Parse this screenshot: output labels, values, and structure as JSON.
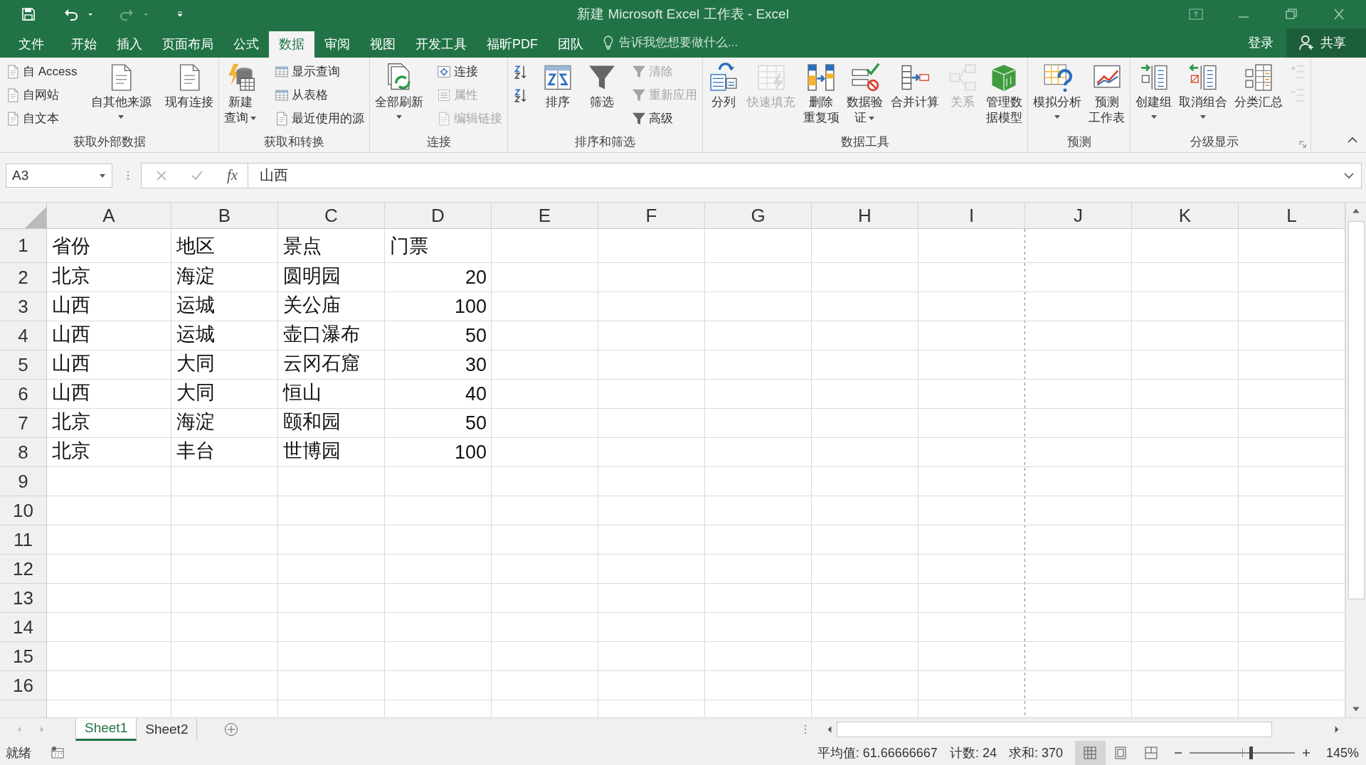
{
  "window": {
    "title": "新建 Microsoft Excel 工作表 - Excel"
  },
  "ribbon_tabs": [
    {
      "label": "文件",
      "selected": false
    },
    {
      "label": "开始",
      "selected": false
    },
    {
      "label": "插入",
      "selected": false
    },
    {
      "label": "页面布局",
      "selected": false
    },
    {
      "label": "公式",
      "selected": false
    },
    {
      "label": "数据",
      "selected": true
    },
    {
      "label": "审阅",
      "selected": false
    },
    {
      "label": "视图",
      "selected": false
    },
    {
      "label": "开发工具",
      "selected": false
    },
    {
      "label": "福昕PDF",
      "selected": false
    },
    {
      "label": "团队",
      "selected": false
    }
  ],
  "tell_me": {
    "placeholder": "告诉我您想要做什么..."
  },
  "account": {
    "sign_in": "登录",
    "share": "共享"
  },
  "ribbon": {
    "groups": [
      {
        "label": "获取外部数据",
        "items": [
          {
            "kind": "stack",
            "buttons": [
              {
                "label": "自 Access",
                "disabled": false
              },
              {
                "label": "自网站",
                "disabled": false
              },
              {
                "label": "自文本",
                "disabled": false
              }
            ]
          },
          {
            "kind": "large",
            "lines": [
              "自其他来源"
            ],
            "dropdown": true,
            "disabled": false
          },
          {
            "kind": "large",
            "lines": [
              "现有连接"
            ],
            "dropdown": false,
            "disabled": false
          }
        ]
      },
      {
        "label": "获取和转换",
        "items": [
          {
            "kind": "large",
            "lines": [
              "新建",
              "查询"
            ],
            "dropdown": true,
            "disabled": false
          },
          {
            "kind": "stack",
            "buttons": [
              {
                "label": "显示查询",
                "disabled": false
              },
              {
                "label": "从表格",
                "disabled": false
              },
              {
                "label": "最近使用的源",
                "disabled": false
              }
            ]
          }
        ]
      },
      {
        "label": "连接",
        "items": [
          {
            "kind": "large",
            "lines": [
              "全部刷新"
            ],
            "dropdown": true,
            "disabled": false
          },
          {
            "kind": "stack",
            "buttons": [
              {
                "label": "连接",
                "disabled": false
              },
              {
                "label": "属性",
                "disabled": true
              },
              {
                "label": "编辑链接",
                "disabled": true
              }
            ]
          }
        ]
      },
      {
        "label": "排序和筛选",
        "items": [
          {
            "kind": "stack",
            "buttons": [
              {
                "disabled": false
              },
              {
                "disabled": false
              }
            ]
          },
          {
            "kind": "large",
            "lines": [
              "排序"
            ],
            "dropdown": false,
            "disabled": false
          },
          {
            "kind": "large",
            "lines": [
              "筛选"
            ],
            "dropdown": false,
            "disabled": false
          },
          {
            "kind": "stack",
            "buttons": [
              {
                "label": "清除",
                "disabled": true
              },
              {
                "label": "重新应用",
                "disabled": true
              },
              {
                "label": "高级",
                "disabled": false
              }
            ]
          }
        ]
      },
      {
        "label": "数据工具",
        "items": [
          {
            "kind": "large",
            "lines": [
              "分列"
            ],
            "dropdown": false,
            "disabled": false
          },
          {
            "kind": "large",
            "lines": [
              "快速填充"
            ],
            "dropdown": false,
            "disabled": true
          },
          {
            "kind": "large",
            "lines": [
              "删除",
              "重复项"
            ],
            "dropdown": false,
            "disabled": false
          },
          {
            "kind": "large",
            "lines": [
              "数据验",
              "证"
            ],
            "dropdown": true,
            "disabled": false
          },
          {
            "kind": "large",
            "lines": [
              "合并计算"
            ],
            "dropdown": false,
            "disabled": false
          },
          {
            "kind": "large",
            "lines": [
              "关系"
            ],
            "dropdown": false,
            "disabled": true
          },
          {
            "kind": "large",
            "lines": [
              "管理数",
              "据模型"
            ],
            "dropdown": false,
            "disabled": false
          }
        ]
      },
      {
        "label": "预测",
        "items": [
          {
            "kind": "large",
            "lines": [
              "模拟分析"
            ],
            "dropdown": true,
            "disabled": false
          },
          {
            "kind": "large",
            "lines": [
              "预测",
              "工作表"
            ],
            "dropdown": false,
            "disabled": false
          }
        ]
      },
      {
        "label": "分级显示",
        "items": [
          {
            "kind": "large",
            "lines": [
              "创建组"
            ],
            "dropdown": true,
            "disabled": false
          },
          {
            "kind": "large",
            "lines": [
              "取消组合"
            ],
            "dropdown": true,
            "disabled": false
          },
          {
            "kind": "large",
            "lines": [
              "分类汇总"
            ],
            "dropdown": false,
            "disabled": false
          },
          {
            "kind": "stack",
            "buttons": [
              {
                "disabled": true
              },
              {
                "disabled": true
              }
            ]
          }
        ]
      }
    ]
  },
  "name_box": {
    "value": "A3"
  },
  "formula_bar": {
    "function_label": "fx",
    "value": "山西"
  },
  "sheet": {
    "columns": [
      "A",
      "B",
      "C",
      "D",
      "E",
      "F",
      "G",
      "H",
      "I",
      "J",
      "K",
      "L"
    ],
    "rows": [
      {
        "header": "1",
        "cells": [
          {
            "text": "省份",
            "kind": "text"
          },
          {
            "text": "地区",
            "kind": "text"
          },
          {
            "text": "景点",
            "kind": "text"
          },
          {
            "text": "门票",
            "kind": "text"
          }
        ]
      },
      {
        "header": "2",
        "cells": [
          {
            "text": "北京",
            "kind": "text"
          },
          {
            "text": "海淀",
            "kind": "text"
          },
          {
            "text": "圆明园",
            "kind": "text"
          },
          {
            "text": "20",
            "kind": "number"
          }
        ]
      },
      {
        "header": "3",
        "cells": [
          {
            "text": "山西",
            "kind": "text"
          },
          {
            "text": "运城",
            "kind": "text"
          },
          {
            "text": "关公庙",
            "kind": "text"
          },
          {
            "text": "100",
            "kind": "number"
          }
        ]
      },
      {
        "header": "4",
        "cells": [
          {
            "text": "山西",
            "kind": "text"
          },
          {
            "text": "运城",
            "kind": "text"
          },
          {
            "text": "壶口瀑布",
            "kind": "text"
          },
          {
            "text": "50",
            "kind": "number"
          }
        ]
      },
      {
        "header": "5",
        "cells": [
          {
            "text": "山西",
            "kind": "text"
          },
          {
            "text": "大同",
            "kind": "text"
          },
          {
            "text": "云冈石窟",
            "kind": "text"
          },
          {
            "text": "30",
            "kind": "number"
          }
        ]
      },
      {
        "header": "6",
        "cells": [
          {
            "text": "山西",
            "kind": "text"
          },
          {
            "text": "大同",
            "kind": "text"
          },
          {
            "text": "恒山",
            "kind": "text"
          },
          {
            "text": "40",
            "kind": "number"
          }
        ]
      },
      {
        "header": "7",
        "cells": [
          {
            "text": "北京",
            "kind": "text"
          },
          {
            "text": "海淀",
            "kind": "text"
          },
          {
            "text": "颐和园",
            "kind": "text"
          },
          {
            "text": "50",
            "kind": "number"
          }
        ]
      },
      {
        "header": "8",
        "cells": [
          {
            "text": "北京",
            "kind": "text"
          },
          {
            "text": "丰台",
            "kind": "text"
          },
          {
            "text": "世博园",
            "kind": "text"
          },
          {
            "text": "100",
            "kind": "number"
          }
        ]
      },
      {
        "header": "9",
        "cells": []
      },
      {
        "header": "10",
        "cells": []
      },
      {
        "header": "11",
        "cells": []
      },
      {
        "header": "12",
        "cells": []
      },
      {
        "header": "13",
        "cells": []
      },
      {
        "header": "14",
        "cells": []
      },
      {
        "header": "15",
        "cells": []
      },
      {
        "header": "16",
        "cells": []
      }
    ]
  },
  "sheet_tabs": [
    {
      "label": "Sheet1",
      "selected": true
    },
    {
      "label": "Sheet2",
      "selected": false
    }
  ],
  "status_bar": {
    "mode": "就绪",
    "stats": [
      "平均值: 61.66666667",
      "计数: 24",
      "求和: 370"
    ],
    "views": [
      {
        "selected": true
      },
      {
        "selected": false
      },
      {
        "selected": false
      }
    ],
    "zoom": {
      "level": 0.58,
      "label": "145%"
    }
  }
}
